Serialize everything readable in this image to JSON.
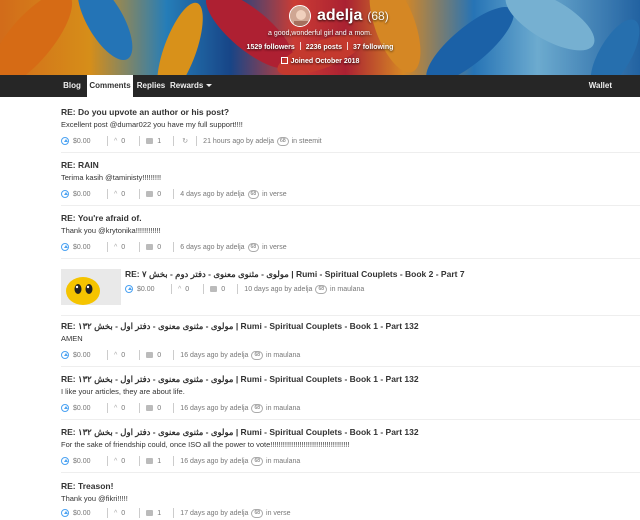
{
  "profile": {
    "name": "adelja",
    "reputation": "(68)",
    "about": "a good,wonderful girl and a mom.",
    "followers": "1529 followers",
    "posts": "2236 posts",
    "following": "37 following",
    "joined": "Joined October 2018"
  },
  "nav": {
    "tabs": [
      "Blog",
      "Comments",
      "Replies",
      "Rewards"
    ],
    "active_tab": "Comments",
    "wallet": "Wallet"
  },
  "rep_badge": "68",
  "by_label": "by",
  "in_label": "in",
  "posts": [
    {
      "title": "RE: Do you upvote an author or his post?",
      "body": "Excellent post @dumar022 you have my full support!!!!",
      "payout": "$0.00",
      "votes": "0",
      "comments": "1",
      "time": "21 hours ago",
      "author": "adelja",
      "category": "steemit"
    },
    {
      "title": "RE: RAIN",
      "body": "Terima kasih @taministy!!!!!!!!!",
      "payout": "$0.00",
      "votes": "0",
      "comments": "0",
      "time": "4 days ago",
      "author": "adelja",
      "category": "verse"
    },
    {
      "title": "RE: You're afraid of.",
      "body": "Thank you @krytonika!!!!!!!!!!!!",
      "payout": "$0.00",
      "votes": "0",
      "comments": "0",
      "time": "6 days ago",
      "author": "adelja",
      "category": "verse"
    },
    {
      "title": "RE: مولوی - مثنوی معنوی - دفتر دوم - بخش ۷ | Rumi - Spiritual Couplets - Book 2 - Part 7",
      "body": "",
      "payout": "$0.00",
      "votes": "0",
      "comments": "0",
      "time": "10 days ago",
      "author": "adelja",
      "category": "maulana"
    },
    {
      "title": "RE: مولوی - مثنوی معنوی - دفتر اول - بخش ۱۳۲ | Rumi - Spiritual Couplets - Book 1 - Part 132",
      "body": "AMEN",
      "payout": "$0.00",
      "votes": "0",
      "comments": "0",
      "time": "16 days ago",
      "author": "adelja",
      "category": "maulana"
    },
    {
      "title": "RE: مولوی - مثنوی معنوی - دفتر اول - بخش ۱۳۲ | Rumi - Spiritual Couplets - Book 1 - Part 132",
      "body": "I like your articles, they are about life.",
      "payout": "$0.00",
      "votes": "0",
      "comments": "0",
      "time": "16 days ago",
      "author": "adelja",
      "category": "maulana"
    },
    {
      "title": "RE: مولوی - مثنوی معنوی - دفتر اول - بخش ۱۳۲ | Rumi - Spiritual Couplets - Book 1 - Part 132",
      "body": "For the sake of friendship could, once ISO all the power to vote!!!!!!!!!!!!!!!!!!!!!!!!!!!!!!!!!!!!!!",
      "payout": "$0.00",
      "votes": "0",
      "comments": "1",
      "time": "16 days ago",
      "author": "adelja",
      "category": "maulana"
    },
    {
      "title": "RE: Treason!",
      "body": "Thank you @fikri!!!!!",
      "payout": "$0.00",
      "votes": "0",
      "comments": "1",
      "time": "17 days ago",
      "author": "adelja",
      "category": "verse"
    }
  ]
}
